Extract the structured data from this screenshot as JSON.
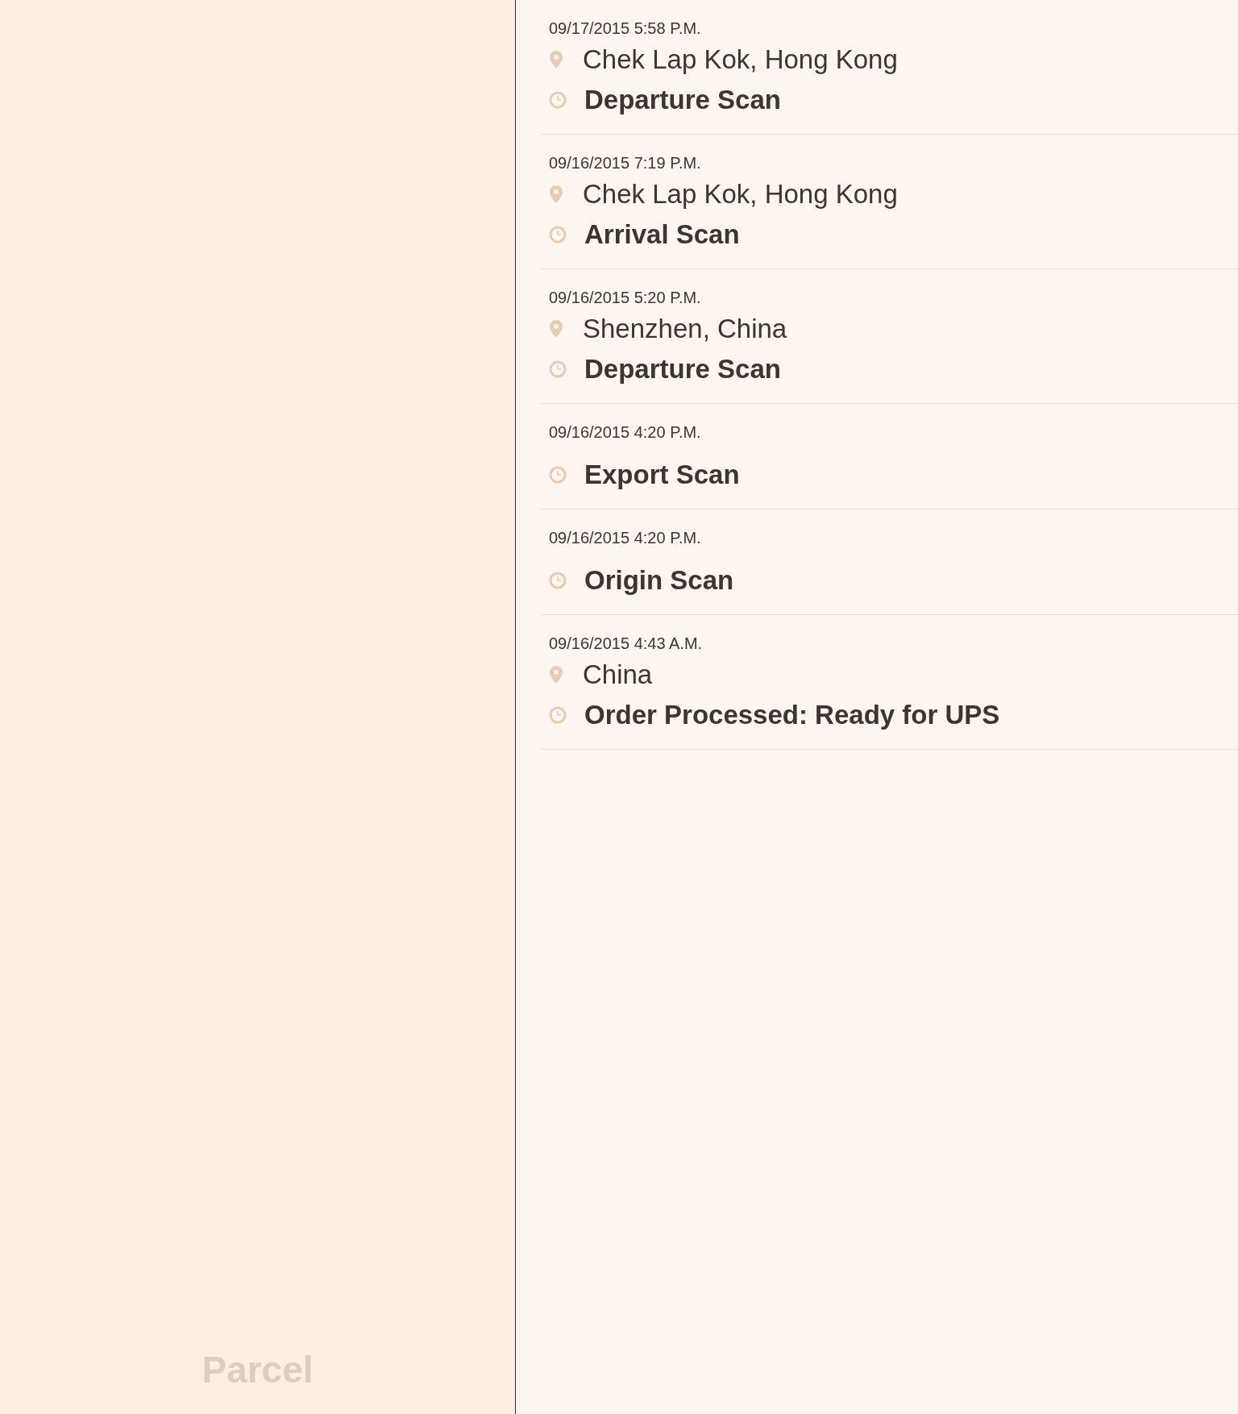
{
  "sidebar": {
    "logo": "Parcel"
  },
  "events": [
    {
      "time": "09/17/2015 5:58 P.M.",
      "location": "Chek Lap Kok, Hong Kong",
      "status": "Departure Scan"
    },
    {
      "time": "09/16/2015 7:19 P.M.",
      "location": "Chek Lap Kok, Hong Kong",
      "status": "Arrival Scan"
    },
    {
      "time": "09/16/2015 5:20 P.M.",
      "location": "Shenzhen, China",
      "status": "Departure Scan"
    },
    {
      "time": "09/16/2015 4:20 P.M.",
      "status": "Export Scan"
    },
    {
      "time": "09/16/2015 4:20 P.M.",
      "status": "Origin Scan"
    },
    {
      "time": "09/16/2015 4:43 A.M.",
      "location": "China",
      "status": "Order Processed: Ready for UPS"
    }
  ]
}
